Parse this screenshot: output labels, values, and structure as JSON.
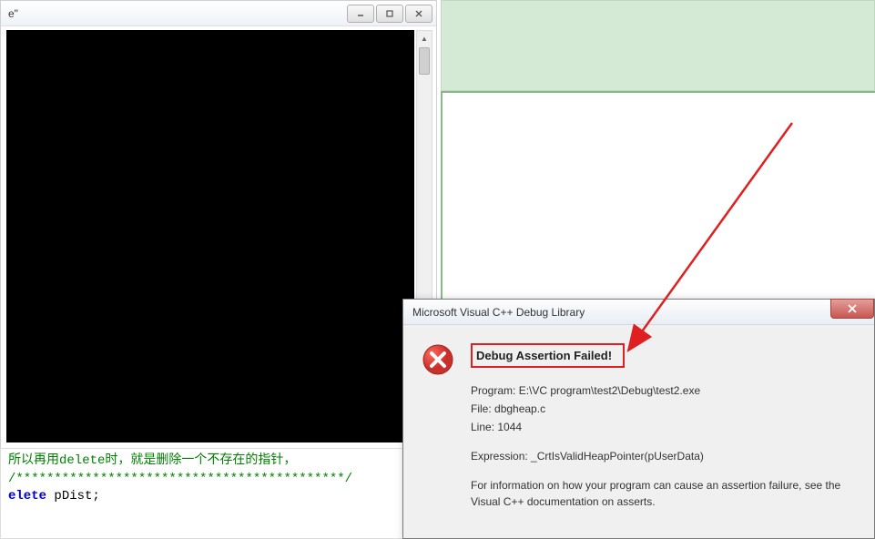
{
  "console": {
    "title_suffix": "e\""
  },
  "code": {
    "comment_line": "所以再用delete时，就是删除一个不存在的指针，",
    "stars_line": "/*******************************************/",
    "delete_keyword": "elete",
    "delete_identifier": " pDist;"
  },
  "dialog": {
    "title": "Microsoft Visual C++ Debug Library",
    "heading": "Debug Assertion Failed!",
    "program_label": "Program: ",
    "program_value": "E:\\VC program\\test2\\Debug\\test2.exe",
    "file_label": "File: ",
    "file_value": "dbgheap.c",
    "line_label": "Line: ",
    "line_value": "1044",
    "expression_label": "Expression: ",
    "expression_value": "_CrtIsValidHeapPointer(pUserData)",
    "info_text": "For information on how your program can cause an assertion failure, see the Visual C++ documentation on asserts."
  }
}
